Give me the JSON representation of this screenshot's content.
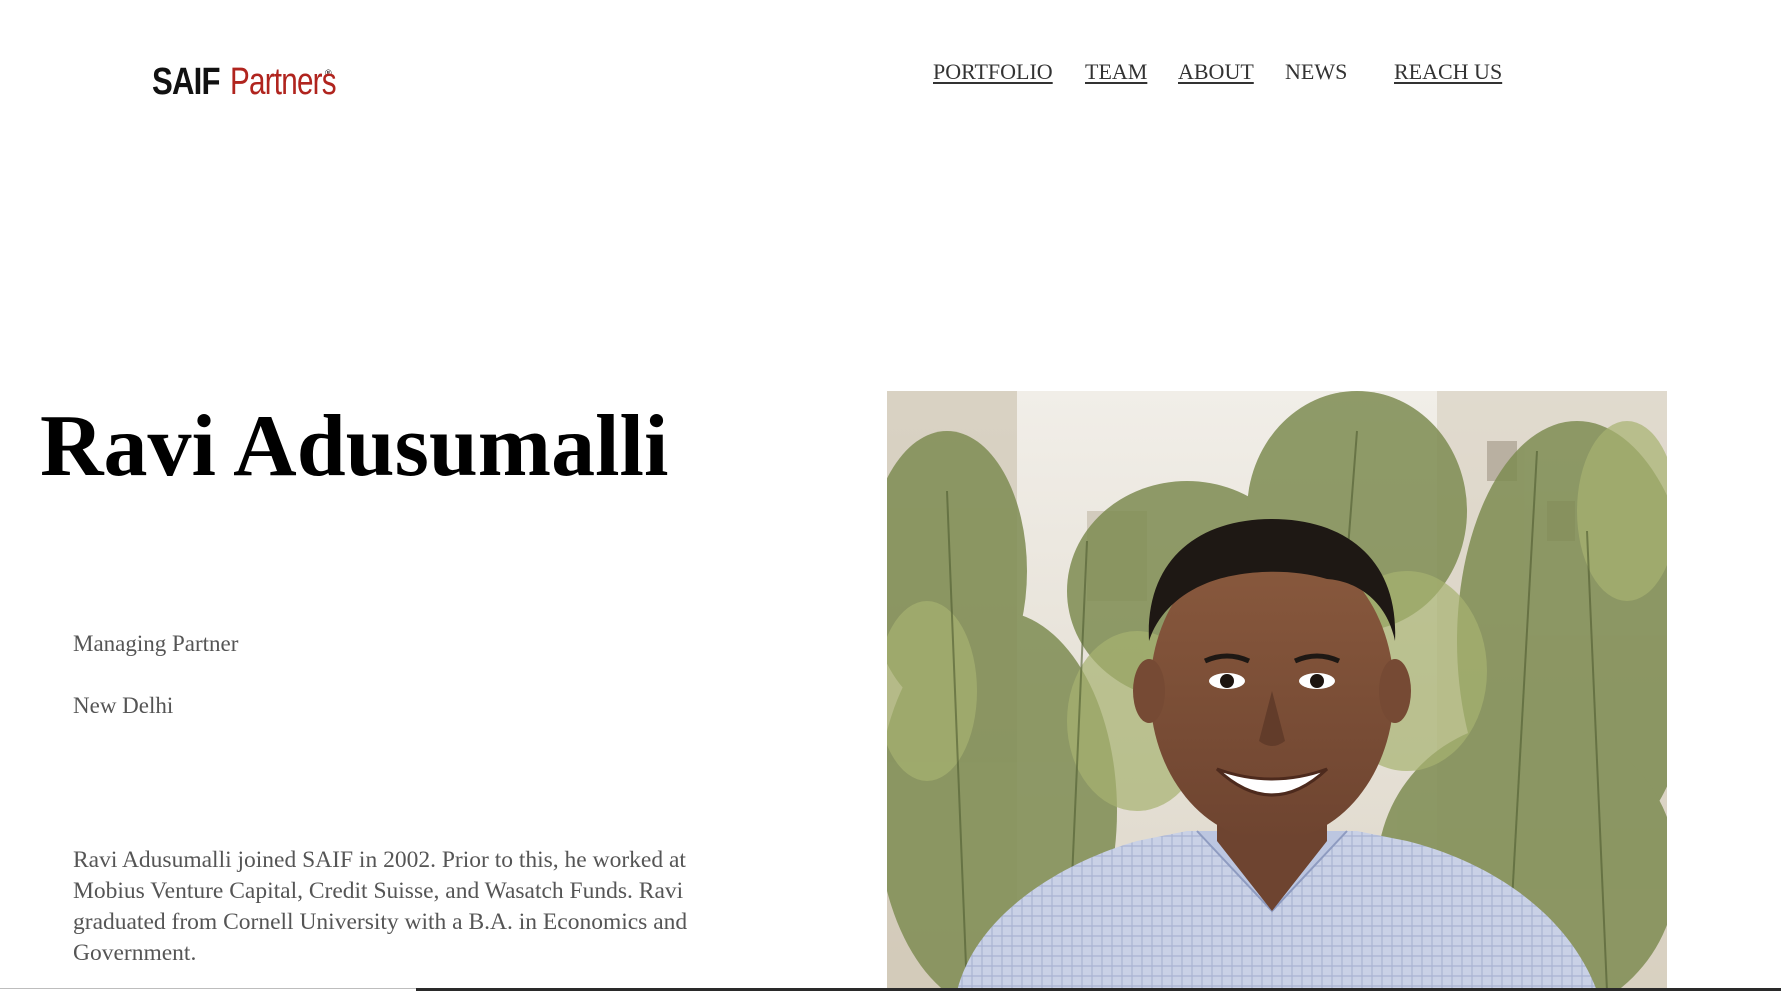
{
  "header": {
    "logo": {
      "primary": "SAIF",
      "secondary": "Partners",
      "registered": "®",
      "alt": "SAIF Partners logo"
    },
    "nav": [
      {
        "label": "PORTFOLIO",
        "underlined": true
      },
      {
        "label": "TEAM",
        "underlined": true
      },
      {
        "label": "ABOUT",
        "underlined": true
      },
      {
        "label": "NEWS",
        "underlined": false
      },
      {
        "label": "REACH US",
        "underlined": true
      }
    ]
  },
  "profile": {
    "name": "Ravi Adusumalli",
    "role": "Managing Partner",
    "location": "New Delhi",
    "bio": "Ravi Adusumalli joined SAIF in 2002. Prior to this, he worked at Mobius Venture Capital, Credit Suisse, and Wasatch Funds. Ravi graduated from Cornell University with a B.A. in Economics and Government.",
    "photo_alt": "Portrait of Ravi Adusumalli"
  },
  "colors": {
    "brand_red": "#b0241e",
    "brand_dark": "#111111",
    "heading": "#000000",
    "body_text": "#555555",
    "nav_text": "#333333"
  }
}
